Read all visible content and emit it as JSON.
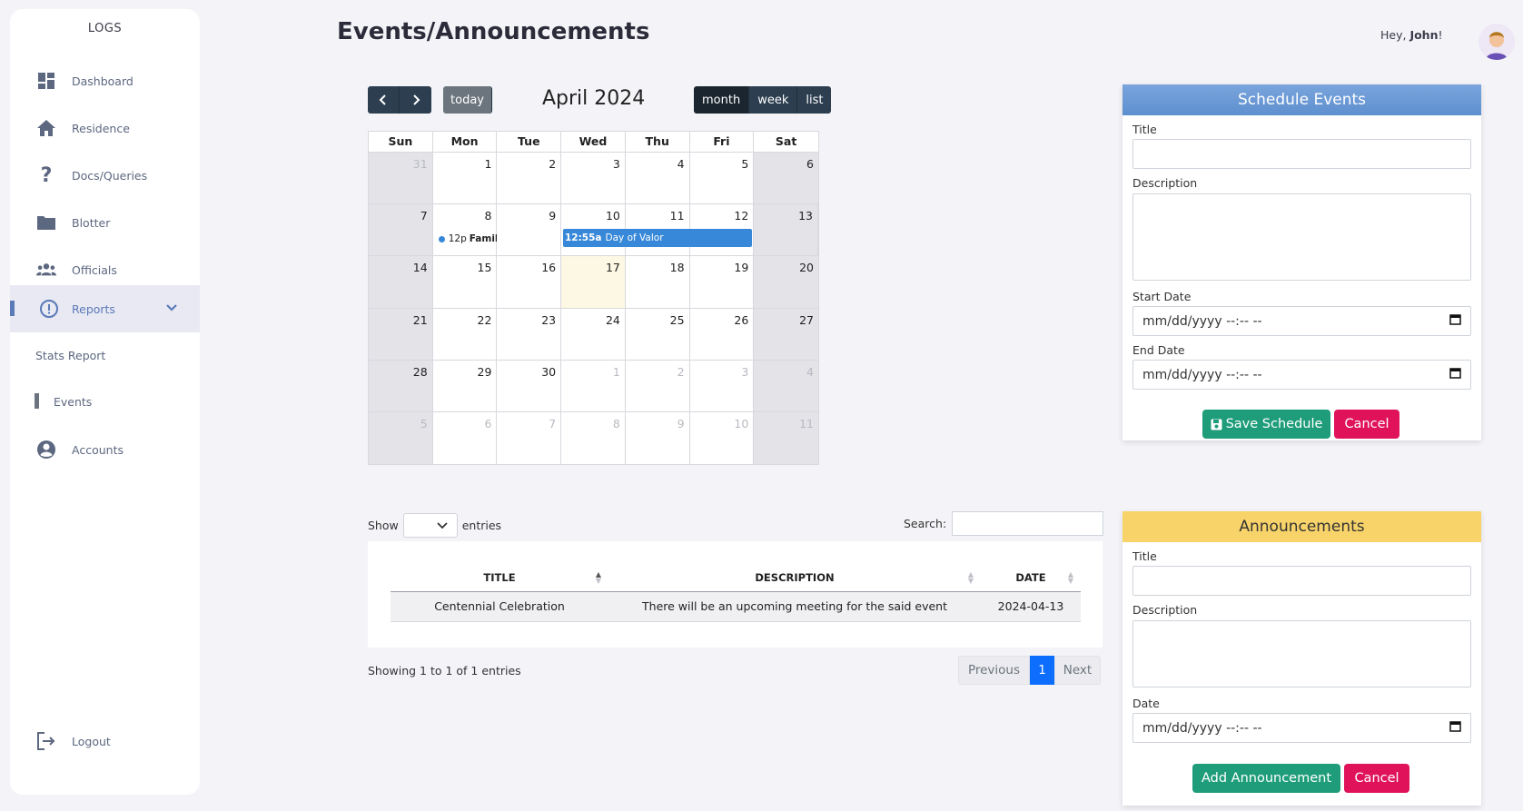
{
  "sidebar": {
    "logo": "LOGS",
    "items": [
      {
        "label": "Dashboard",
        "icon": "dashboard-icon"
      },
      {
        "label": "Residence",
        "icon": "home-icon"
      },
      {
        "label": "Docs/Queries",
        "icon": "question-icon"
      },
      {
        "label": "Blotter",
        "icon": "folder-icon"
      },
      {
        "label": "Officials",
        "icon": "group-icon"
      },
      {
        "label": "Reports",
        "icon": "alert-circle-icon"
      }
    ],
    "sub_items": [
      {
        "label": "Stats Report"
      },
      {
        "label": "Events"
      }
    ],
    "accounts": "Accounts",
    "logout": "Logout"
  },
  "header": {
    "title": "Events/Announcements",
    "greeting_prefix": "Hey, ",
    "user": "John",
    "greeting_suffix": "!"
  },
  "calendar": {
    "title": "April 2024",
    "today_label": "today",
    "views": [
      "month",
      "week",
      "list"
    ],
    "active_view": "month",
    "weekdays": [
      "Sun",
      "Mon",
      "Tue",
      "Wed",
      "Thu",
      "Fri",
      "Sat"
    ],
    "weeks": [
      [
        "31",
        "1",
        "2",
        "3",
        "4",
        "5",
        "6"
      ],
      [
        "7",
        "8",
        "9",
        "10",
        "11",
        "12",
        "13"
      ],
      [
        "14",
        "15",
        "16",
        "17",
        "18",
        "19",
        "20"
      ],
      [
        "21",
        "22",
        "23",
        "24",
        "25",
        "26",
        "27"
      ],
      [
        "28",
        "29",
        "30",
        "1",
        "2",
        "3",
        "4"
      ],
      [
        "5",
        "6",
        "7",
        "8",
        "9",
        "10",
        "11"
      ]
    ],
    "events": [
      {
        "time": "12p",
        "title": "Famil",
        "date": "2024-04-08"
      },
      {
        "time": "12:55a",
        "title": "Day of Valor",
        "start": "2024-04-10",
        "end": "2024-04-12"
      }
    ]
  },
  "table": {
    "show_label": "Show",
    "entries_label": "entries",
    "search_label": "Search:",
    "columns": [
      "TITLE",
      "DESCRIPTION",
      "DATE"
    ],
    "rows": [
      [
        "Centennial Celebration",
        "There will be an upcoming meeting for the said event",
        "2024-04-13"
      ]
    ],
    "info": "Showing 1 to 1 of 1 entries",
    "pager": {
      "previous": "Previous",
      "current": "1",
      "next": "Next"
    }
  },
  "schedule": {
    "title": "Schedule Events",
    "title_label": "Title",
    "description_label": "Description",
    "start_label": "Start Date",
    "end_label": "End Date",
    "date_placeholder": "mm/dd/yyyy --:-- --",
    "save_label": "Save Schedule",
    "cancel_label": "Cancel"
  },
  "announcement": {
    "title": "Announcements",
    "title_label": "Title",
    "description_label": "Description",
    "date_label": "Date",
    "date_placeholder": "mm/dd/yyyy --:-- --",
    "add_label": "Add Announcement",
    "cancel_label": "Cancel"
  },
  "colors": {
    "accent": "#5a7ab8",
    "calendar_event": "#3788d8",
    "save_button": "#1f9d7a",
    "cancel_button": "#e0135a",
    "schedule_header": "#6b99d6",
    "announcement_header": "#f7d36a"
  }
}
